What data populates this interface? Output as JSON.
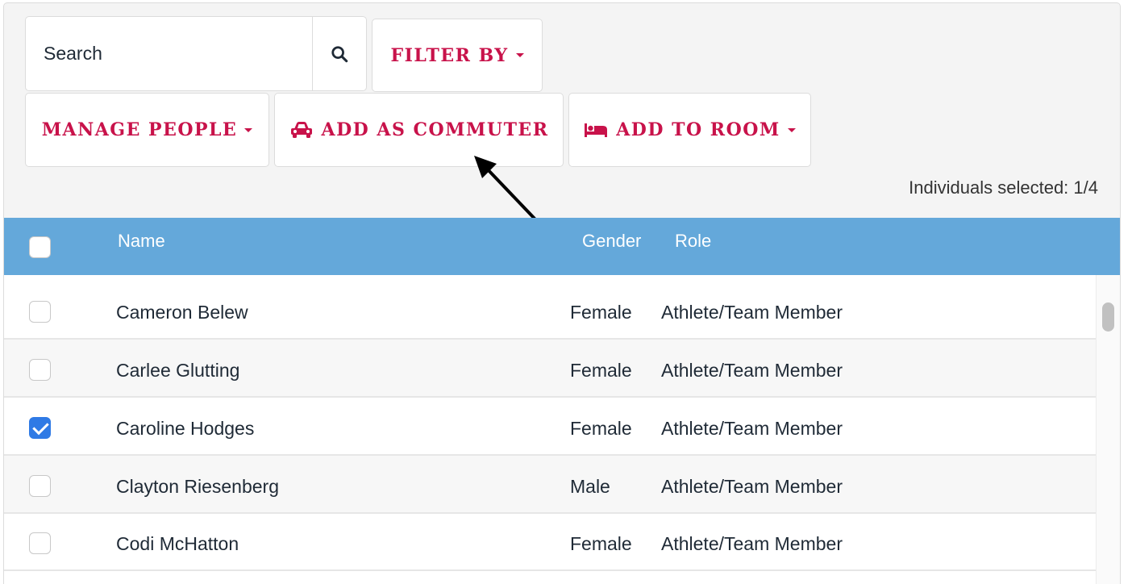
{
  "search": {
    "placeholder": "Search"
  },
  "toolbar": {
    "filter_label": "FILTER BY",
    "manage_label": "MANAGE PEOPLE",
    "commuter_label": "ADD AS COMMUTER",
    "room_label": "ADD TO ROOM",
    "accent_color": "#c8124a"
  },
  "selection": {
    "count_text": "Individuals selected: 1/4"
  },
  "table": {
    "header_color": "#64a8da",
    "columns": {
      "name": "Name",
      "gender": "Gender",
      "role": "Role"
    },
    "rows": [
      {
        "name": "Cameron Belew",
        "gender": "Female",
        "role": "Athlete/Team Member",
        "checked": false
      },
      {
        "name": "Carlee Glutting",
        "gender": "Female",
        "role": "Athlete/Team Member",
        "checked": false
      },
      {
        "name": "Caroline Hodges",
        "gender": "Female",
        "role": "Athlete/Team Member",
        "checked": true
      },
      {
        "name": "Clayton Riesenberg",
        "gender": "Male",
        "role": "Athlete/Team Member",
        "checked": false
      },
      {
        "name": "Codi McHatton",
        "gender": "Female",
        "role": "Athlete/Team Member",
        "checked": false
      }
    ]
  },
  "icons": {
    "search": "search-icon",
    "car": "car-icon",
    "bed": "bed-icon",
    "caret": "caret-down-icon",
    "annotation": "arrow-annotation"
  }
}
